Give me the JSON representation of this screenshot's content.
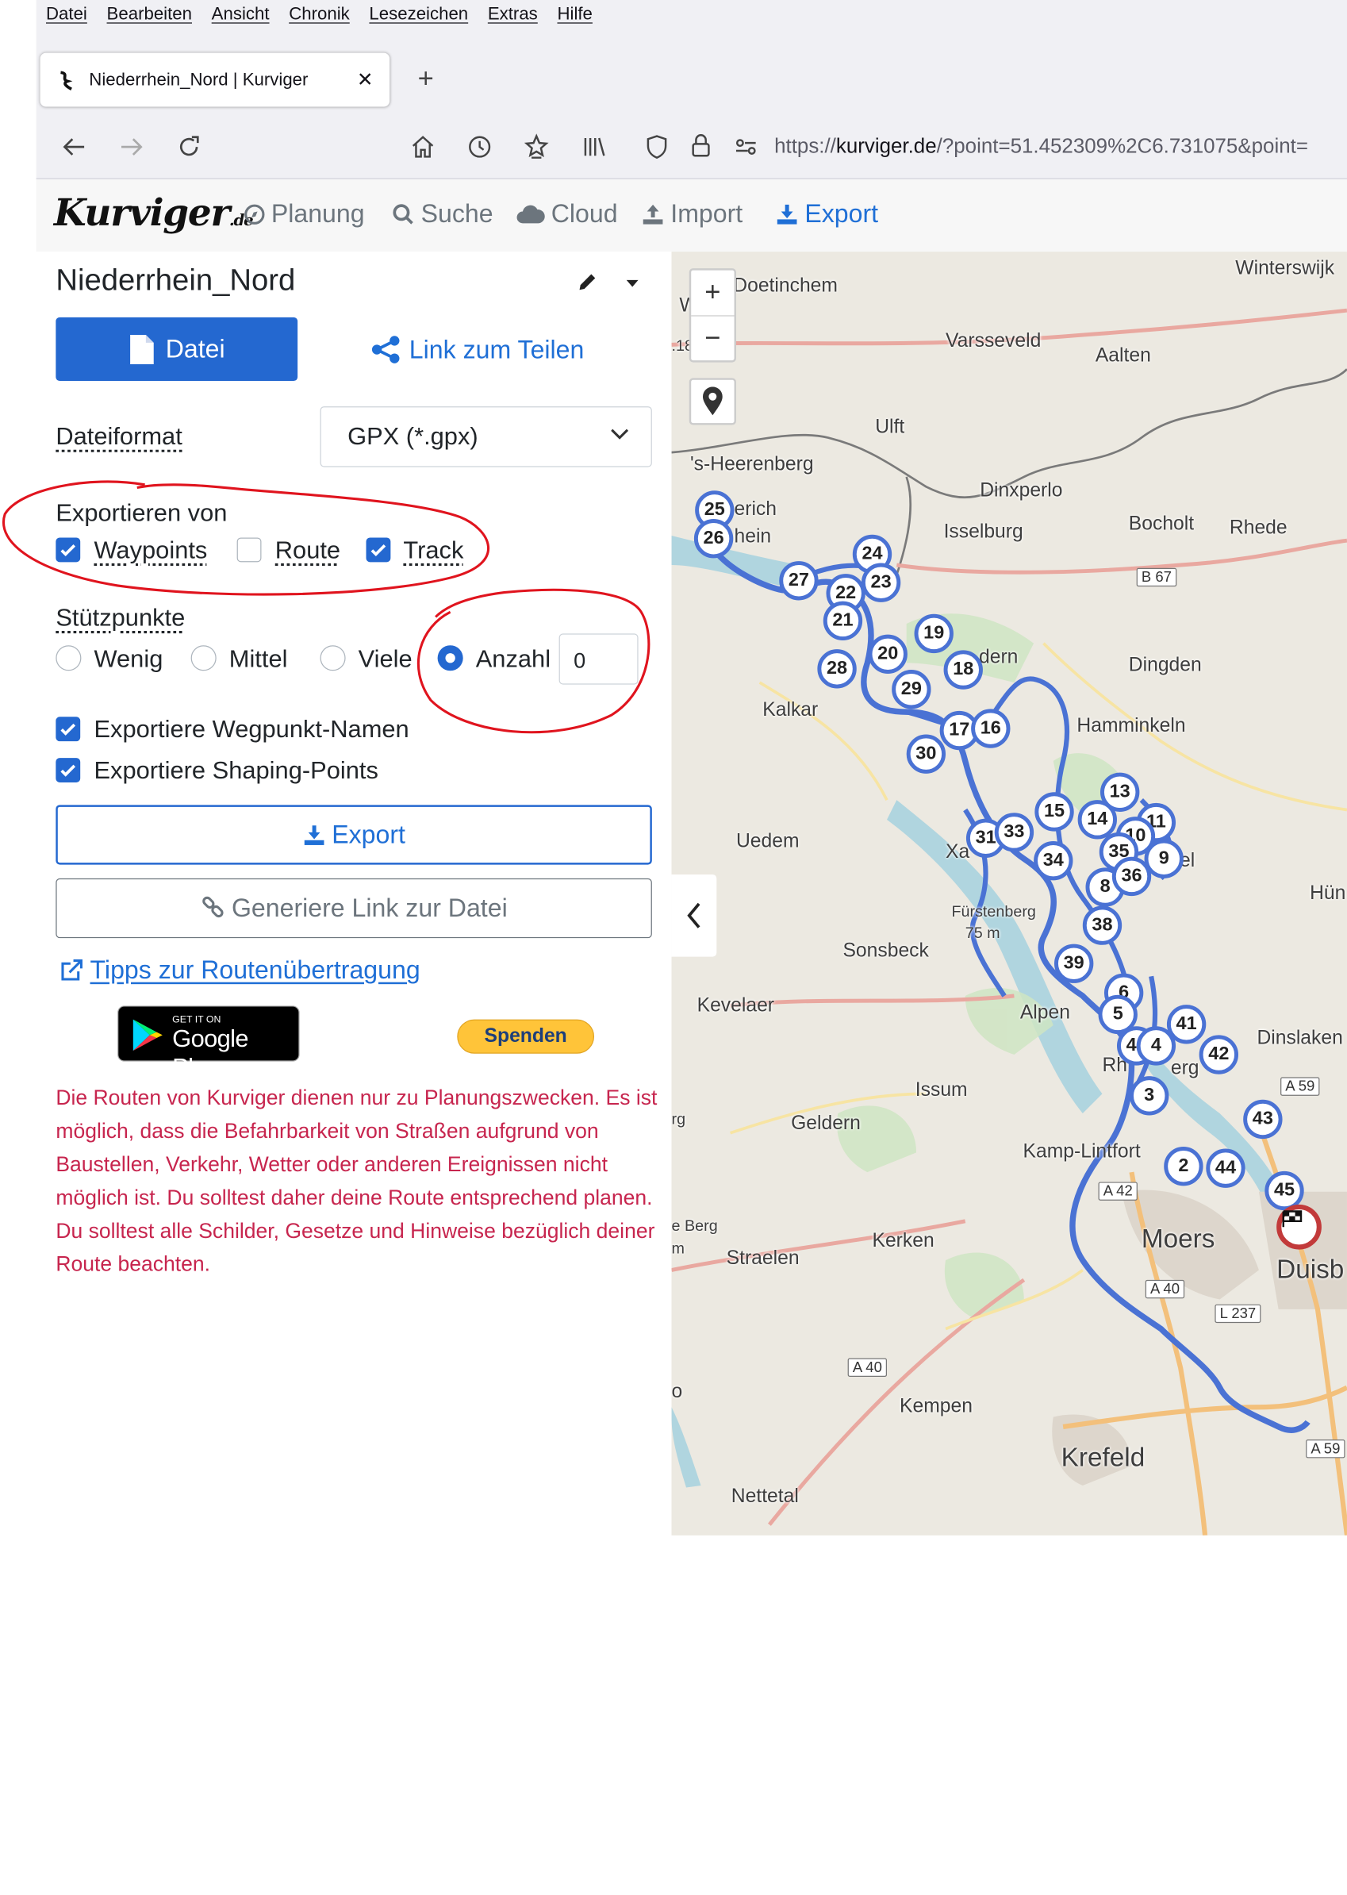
{
  "browser": {
    "menu": [
      "Datei",
      "Bearbeiten",
      "Ansicht",
      "Chronik",
      "Lesezeichen",
      "Extras",
      "Hilfe"
    ],
    "tab_title": "Niederrhein_Nord | Kurviger",
    "url_prefix": "https://",
    "url_host": "kurviger.de",
    "url_rest": "/?point=51.452309%2C6.731075&point="
  },
  "app": {
    "logo": "Kurviger",
    "logo_suffix": ".de",
    "nav": {
      "planung": "Planung",
      "suche": "Suche",
      "cloud": "Cloud",
      "import": "Import",
      "export": "Export"
    }
  },
  "panel": {
    "title": "Niederrhein_Nord",
    "datei_button": "Datei",
    "link_teilen": "Link zum Teilen",
    "dateiformat_label": "Dateiformat",
    "dateiformat_value": "GPX (*.gpx)",
    "exportieren_von_label": "Exportieren von",
    "waypoints": "Waypoints",
    "route": "Route",
    "track": "Track",
    "stuetzpunkte_label": "Stützpunkte",
    "wenig": "Wenig",
    "mittel": "Mittel",
    "viele": "Viele",
    "anzahl": "Anzahl",
    "anzahl_value": "0",
    "export_names": "Exportiere Wegpunkt-Namen",
    "export_shaping": "Exportiere Shaping-Points",
    "export_button": "Export",
    "generate_link_button": "Generiere Link zur Datei",
    "tipps_link": "Tipps zur Routenübertragung",
    "gplay_small": "GET IT ON",
    "gplay_big": "Google Play",
    "spenden": "Spenden",
    "disclaimer": "Die Routen von Kurviger dienen nur zu Planungszwecken. Es ist möglich, dass die Befahrbarkeit von Straßen aufgrund von Baustellen, Verkehr, Wetter oder anderen Ereignissen nicht möglich ist. Du solltest daher deine Route entsprechend planen. Du solltest alle Schilder, Gesetze und Hinweise bezüglich deiner Route beachten."
  },
  "map": {
    "zoom_in": "+",
    "zoom_out": "−",
    "towns": {
      "doetinchem": "Doetinchem",
      "winterswijk": "Winterswijk",
      "varsseveld": "Varsseveld",
      "aalten": "Aalten",
      "ulft": "Ulft",
      "heerenberg": "'s-Heerenberg",
      "dinxperlo": "Dinxperlo",
      "isselburg": "Isselburg",
      "bocholt": "Bocholt",
      "rhede": "Rhede",
      "dingden": "Dingden",
      "kalkar": "Kalkar",
      "hamminkeln": "Hamminkeln",
      "uedem": "Uedem",
      "sonsbeck": "Sonsbeck",
      "kevelaer": "Kevelaer",
      "alpen": "Alpen",
      "issum": "Issum",
      "geldern": "Geldern",
      "kamplintfort": "Kamp-Lintfort",
      "moers": "Moers",
      "duisb": "Duisb",
      "dinslaken": "Dinslaken",
      "straelen": "Straelen",
      "kerken": "Kerken",
      "kempen": "Kempen",
      "krefeld": "Krefeld",
      "nettetal": "Nettetal",
      "hun": "Hün",
      "fuerstenberg": "Fürstenberg",
      "erich": "erich",
      "rhein": "hein",
      "xa": "Xa",
      "dern": "dern",
      "el": "el",
      "berg": "e Berg",
      "m": "m",
      "rg": "rg",
      "o": "o",
      "w": "W",
      "n18": ".18",
      "alt": "75 m",
      "rh": "Rh",
      "erg": "erg",
      "rg2": "n"
    },
    "shields": {
      "b67": "B 67",
      "a59a": "A 59",
      "a42": "A 42",
      "a40a": "A 40",
      "l237": "L 237",
      "a40b": "A 40",
      "a59b": "A 59"
    },
    "waypoints": [
      "25",
      "26",
      "27",
      "22",
      "24",
      "23",
      "21",
      "19",
      "20",
      "28",
      "18",
      "29",
      "17",
      "16",
      "30",
      "13",
      "15",
      "14",
      "11",
      "10",
      "31",
      "33",
      "35",
      "34",
      "9",
      "8",
      "36",
      "38",
      "39",
      "6",
      "5",
      "41",
      "40",
      "4",
      "42",
      "3",
      "43",
      "2",
      "44",
      "45"
    ],
    "route_color": "#4a72d4"
  }
}
